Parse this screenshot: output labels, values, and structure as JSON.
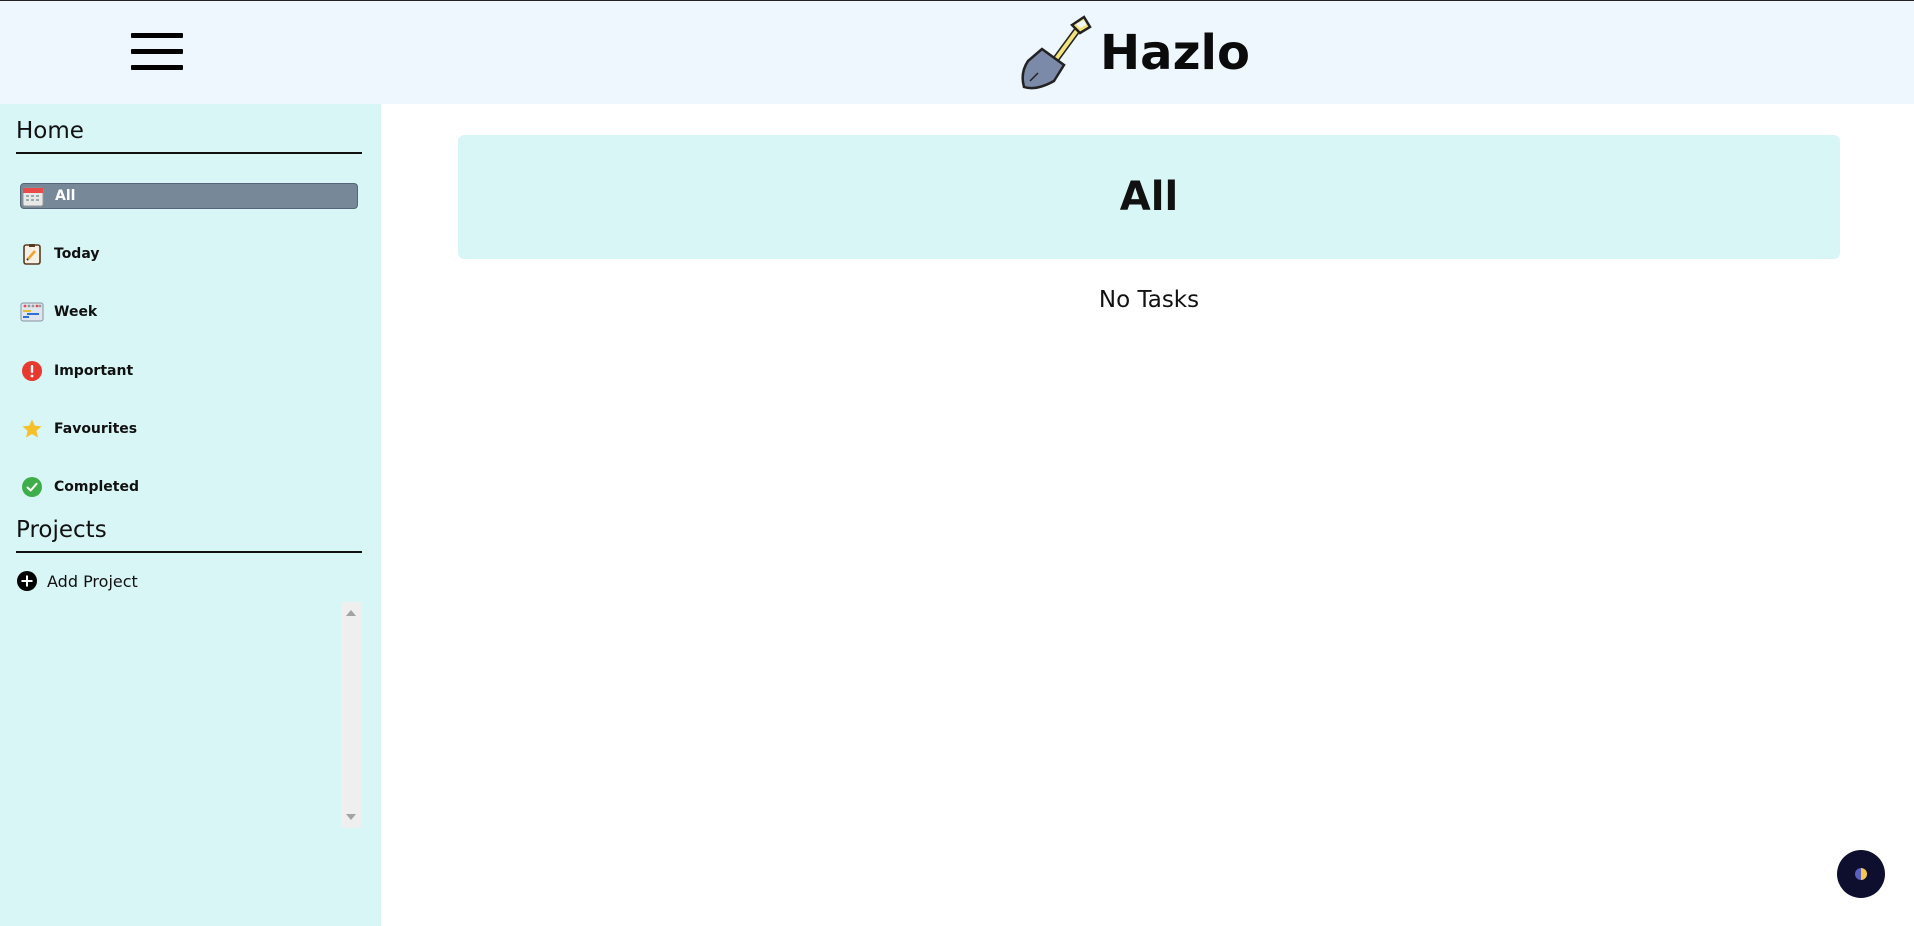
{
  "header": {
    "menu_icon": "hamburger-icon",
    "logo_icon": "shovel-icon",
    "title": "Hazlo"
  },
  "sidebar": {
    "home_title": "Home",
    "items": [
      {
        "label": "All",
        "icon": "calendar-icon",
        "active": true
      },
      {
        "label": "Today",
        "icon": "clipboard-icon",
        "active": false
      },
      {
        "label": "Week",
        "icon": "week-planner-icon",
        "active": false
      },
      {
        "label": "Important",
        "icon": "exclamation-icon",
        "active": false
      },
      {
        "label": "Favourites",
        "icon": "star-icon",
        "active": false
      },
      {
        "label": "Completed",
        "icon": "check-circle-icon",
        "active": false
      }
    ],
    "projects_title": "Projects",
    "add_project_label": "Add Project",
    "add_project_icon": "plus-circle-icon"
  },
  "main": {
    "title": "All",
    "empty_message": "No Tasks"
  },
  "theme_toggle_icon": "half-moon-icon",
  "colors": {
    "topbar_bg": "#eef6fe",
    "sidebar_bg": "#d8f6f6",
    "active_item_bg": "#778899",
    "header_card_bg": "#d8f6f6",
    "theme_button_bg": "#0e0f2e"
  }
}
